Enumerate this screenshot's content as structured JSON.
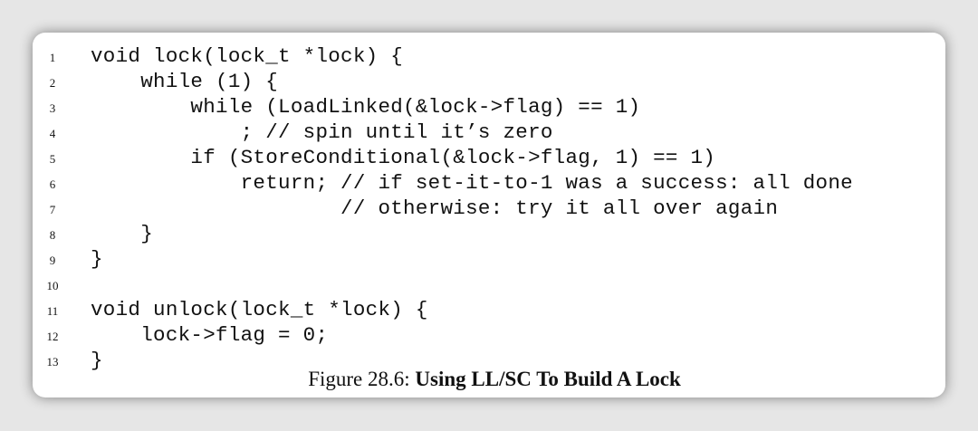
{
  "code": {
    "lines": [
      {
        "num": "1",
        "text": "void lock(lock_t *lock) {"
      },
      {
        "num": "2",
        "text": "    while (1) {"
      },
      {
        "num": "3",
        "text": "        while (LoadLinked(&lock->flag) == 1)"
      },
      {
        "num": "4",
        "text": "            ; // spin until it’s zero"
      },
      {
        "num": "5",
        "text": "        if (StoreConditional(&lock->flag, 1) == 1)"
      },
      {
        "num": "6",
        "text": "            return; // if set-it-to-1 was a success: all done"
      },
      {
        "num": "7",
        "text": "                    // otherwise: try it all over again"
      },
      {
        "num": "8",
        "text": "    }"
      },
      {
        "num": "9",
        "text": "}"
      },
      {
        "num": "10",
        "text": ""
      },
      {
        "num": "11",
        "text": "void unlock(lock_t *lock) {"
      },
      {
        "num": "12",
        "text": "    lock->flag = 0;"
      },
      {
        "num": "13",
        "text": "}"
      }
    ]
  },
  "caption": {
    "label": "Figure 28.6: ",
    "title": "Using LL/SC To Build A Lock"
  }
}
